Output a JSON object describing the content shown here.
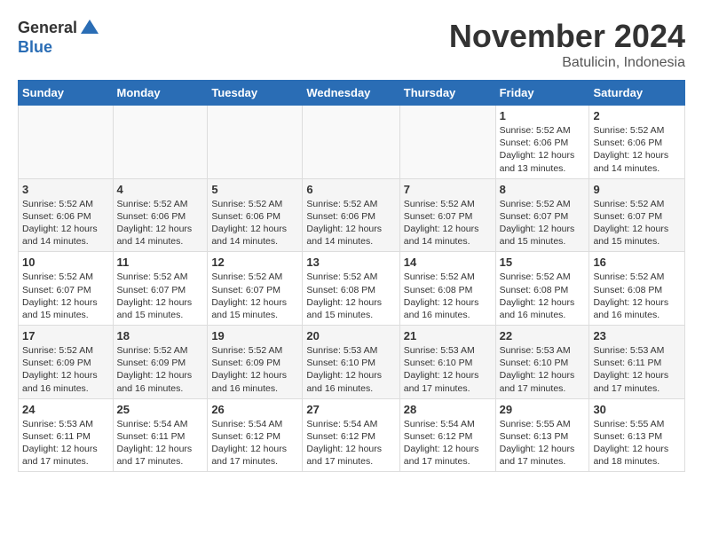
{
  "header": {
    "logo_general": "General",
    "logo_blue": "Blue",
    "month_title": "November 2024",
    "location": "Batulicin, Indonesia"
  },
  "weekdays": [
    "Sunday",
    "Monday",
    "Tuesday",
    "Wednesday",
    "Thursday",
    "Friday",
    "Saturday"
  ],
  "weeks": [
    [
      {
        "day": "",
        "info": ""
      },
      {
        "day": "",
        "info": ""
      },
      {
        "day": "",
        "info": ""
      },
      {
        "day": "",
        "info": ""
      },
      {
        "day": "",
        "info": ""
      },
      {
        "day": "1",
        "info": "Sunrise: 5:52 AM\nSunset: 6:06 PM\nDaylight: 12 hours\nand 13 minutes."
      },
      {
        "day": "2",
        "info": "Sunrise: 5:52 AM\nSunset: 6:06 PM\nDaylight: 12 hours\nand 14 minutes."
      }
    ],
    [
      {
        "day": "3",
        "info": "Sunrise: 5:52 AM\nSunset: 6:06 PM\nDaylight: 12 hours\nand 14 minutes."
      },
      {
        "day": "4",
        "info": "Sunrise: 5:52 AM\nSunset: 6:06 PM\nDaylight: 12 hours\nand 14 minutes."
      },
      {
        "day": "5",
        "info": "Sunrise: 5:52 AM\nSunset: 6:06 PM\nDaylight: 12 hours\nand 14 minutes."
      },
      {
        "day": "6",
        "info": "Sunrise: 5:52 AM\nSunset: 6:06 PM\nDaylight: 12 hours\nand 14 minutes."
      },
      {
        "day": "7",
        "info": "Sunrise: 5:52 AM\nSunset: 6:07 PM\nDaylight: 12 hours\nand 14 minutes."
      },
      {
        "day": "8",
        "info": "Sunrise: 5:52 AM\nSunset: 6:07 PM\nDaylight: 12 hours\nand 15 minutes."
      },
      {
        "day": "9",
        "info": "Sunrise: 5:52 AM\nSunset: 6:07 PM\nDaylight: 12 hours\nand 15 minutes."
      }
    ],
    [
      {
        "day": "10",
        "info": "Sunrise: 5:52 AM\nSunset: 6:07 PM\nDaylight: 12 hours\nand 15 minutes."
      },
      {
        "day": "11",
        "info": "Sunrise: 5:52 AM\nSunset: 6:07 PM\nDaylight: 12 hours\nand 15 minutes."
      },
      {
        "day": "12",
        "info": "Sunrise: 5:52 AM\nSunset: 6:07 PM\nDaylight: 12 hours\nand 15 minutes."
      },
      {
        "day": "13",
        "info": "Sunrise: 5:52 AM\nSunset: 6:08 PM\nDaylight: 12 hours\nand 15 minutes."
      },
      {
        "day": "14",
        "info": "Sunrise: 5:52 AM\nSunset: 6:08 PM\nDaylight: 12 hours\nand 16 minutes."
      },
      {
        "day": "15",
        "info": "Sunrise: 5:52 AM\nSunset: 6:08 PM\nDaylight: 12 hours\nand 16 minutes."
      },
      {
        "day": "16",
        "info": "Sunrise: 5:52 AM\nSunset: 6:08 PM\nDaylight: 12 hours\nand 16 minutes."
      }
    ],
    [
      {
        "day": "17",
        "info": "Sunrise: 5:52 AM\nSunset: 6:09 PM\nDaylight: 12 hours\nand 16 minutes."
      },
      {
        "day": "18",
        "info": "Sunrise: 5:52 AM\nSunset: 6:09 PM\nDaylight: 12 hours\nand 16 minutes."
      },
      {
        "day": "19",
        "info": "Sunrise: 5:52 AM\nSunset: 6:09 PM\nDaylight: 12 hours\nand 16 minutes."
      },
      {
        "day": "20",
        "info": "Sunrise: 5:53 AM\nSunset: 6:10 PM\nDaylight: 12 hours\nand 16 minutes."
      },
      {
        "day": "21",
        "info": "Sunrise: 5:53 AM\nSunset: 6:10 PM\nDaylight: 12 hours\nand 17 minutes."
      },
      {
        "day": "22",
        "info": "Sunrise: 5:53 AM\nSunset: 6:10 PM\nDaylight: 12 hours\nand 17 minutes."
      },
      {
        "day": "23",
        "info": "Sunrise: 5:53 AM\nSunset: 6:11 PM\nDaylight: 12 hours\nand 17 minutes."
      }
    ],
    [
      {
        "day": "24",
        "info": "Sunrise: 5:53 AM\nSunset: 6:11 PM\nDaylight: 12 hours\nand 17 minutes."
      },
      {
        "day": "25",
        "info": "Sunrise: 5:54 AM\nSunset: 6:11 PM\nDaylight: 12 hours\nand 17 minutes."
      },
      {
        "day": "26",
        "info": "Sunrise: 5:54 AM\nSunset: 6:12 PM\nDaylight: 12 hours\nand 17 minutes."
      },
      {
        "day": "27",
        "info": "Sunrise: 5:54 AM\nSunset: 6:12 PM\nDaylight: 12 hours\nand 17 minutes."
      },
      {
        "day": "28",
        "info": "Sunrise: 5:54 AM\nSunset: 6:12 PM\nDaylight: 12 hours\nand 17 minutes."
      },
      {
        "day": "29",
        "info": "Sunrise: 5:55 AM\nSunset: 6:13 PM\nDaylight: 12 hours\nand 17 minutes."
      },
      {
        "day": "30",
        "info": "Sunrise: 5:55 AM\nSunset: 6:13 PM\nDaylight: 12 hours\nand 18 minutes."
      }
    ]
  ]
}
